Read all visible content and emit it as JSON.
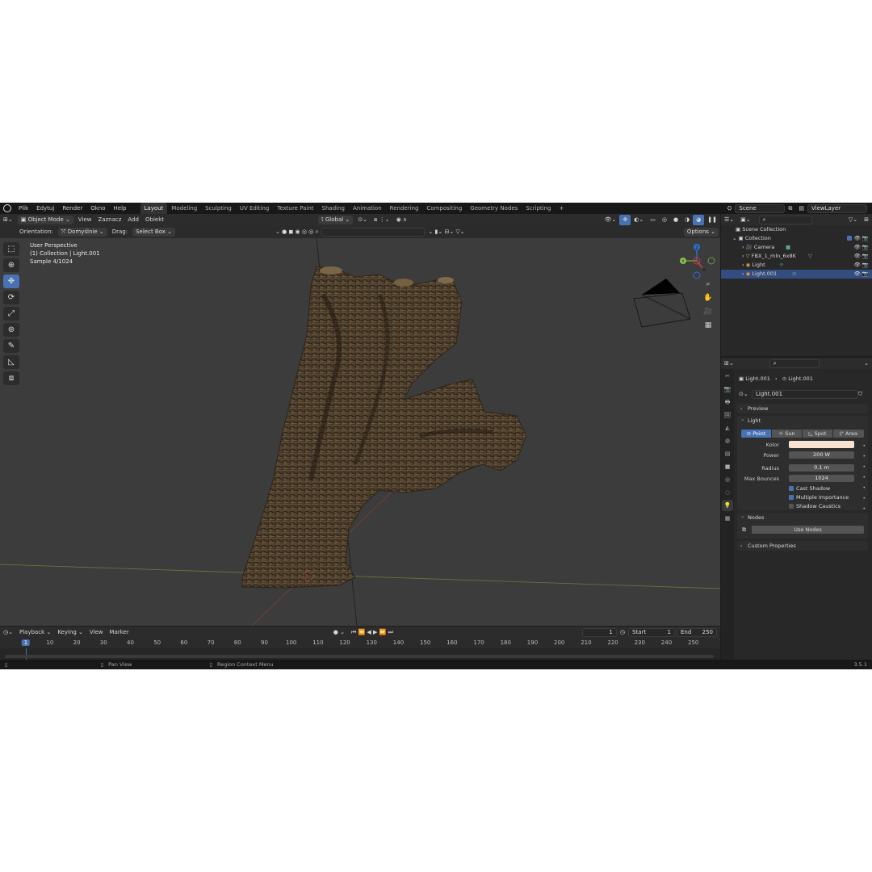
{
  "topbar": {
    "menus": [
      "Plik",
      "Edytuj",
      "Render",
      "Okno",
      "Help"
    ],
    "workspaces": [
      "Layout",
      "Modeling",
      "Sculpting",
      "UV Editing",
      "Texture Paint",
      "Shading",
      "Animation",
      "Rendering",
      "Compositing",
      "Geometry Nodes",
      "Scripting"
    ],
    "active_workspace": "Layout",
    "add_tab": "+",
    "scene": "Scene",
    "view_layer": "ViewLayer"
  },
  "viewport_header": {
    "mode": "Object Mode",
    "menus": [
      "View",
      "Zaznacz",
      "Add",
      "Obiekt"
    ],
    "transform_orientation": "Global",
    "orientation_label": "Orientation:",
    "orientation_value": "Domyślnie",
    "drag_label": "Drag:",
    "drag_value": "Select Box",
    "options_label": "Options"
  },
  "viewport": {
    "perspective": "User Perspective",
    "collection_info": "(1) Collection | Light.001",
    "sample": "Sample 4/1024",
    "gizmo": {
      "x": "X",
      "y": "Y",
      "z": "Z"
    }
  },
  "toolbar": {
    "tools": [
      "select-box-icon",
      "cursor-icon",
      "move-icon",
      "rotate-icon",
      "scale-icon",
      "transform-icon",
      "annotate-icon",
      "measure-icon",
      "add-cube-icon"
    ],
    "active": "move-icon"
  },
  "timeline": {
    "menus": [
      "Playback",
      "Keying",
      "View",
      "Marker"
    ],
    "current_frame": "1",
    "start_label": "Start",
    "start": "1",
    "end_label": "End",
    "end": "250",
    "ruler": [
      "1",
      "10",
      "20",
      "30",
      "40",
      "50",
      "60",
      "70",
      "80",
      "90",
      "100",
      "110",
      "120",
      "130",
      "140",
      "150",
      "160",
      "170",
      "180",
      "190",
      "200",
      "210",
      "220",
      "230",
      "240",
      "250"
    ]
  },
  "statusbar": {
    "pan": "Pan View",
    "context": "Region Context Menu",
    "version": "3.5.1"
  },
  "outliner": {
    "root": "Scene Collection",
    "collection": "Collection",
    "items": [
      {
        "name": "Camera",
        "icon": "camera-icon"
      },
      {
        "name": "FBX_1_mln_6x8K",
        "icon": "mesh-icon"
      },
      {
        "name": "Light",
        "icon": "light-icon"
      },
      {
        "name": "Light.001",
        "icon": "light-icon"
      }
    ]
  },
  "properties": {
    "breadcrumb_object": "Light.001",
    "breadcrumb_data": "Light.001",
    "datablock": "Light.001",
    "panels": {
      "preview": "Preview",
      "light": "Light",
      "nodes": "Nodes",
      "custom": "Custom Properties"
    },
    "light_types": [
      "Point",
      "Sun",
      "Spot",
      "Area"
    ],
    "active_type": "Point",
    "fields": {
      "color_label": "Kolor",
      "color_value": "#f7e2d1",
      "power_label": "Power",
      "power": "200 W",
      "radius_label": "Radius",
      "radius": "0.1 m",
      "bounces_label": "Max Bounces",
      "bounces": "1024"
    },
    "checks": [
      {
        "label": "Cast Shadow",
        "on": true
      },
      {
        "label": "Multiple Importance",
        "on": true
      },
      {
        "label": "Shadow Caustics",
        "on": false
      }
    ],
    "use_nodes": "Use Nodes"
  }
}
